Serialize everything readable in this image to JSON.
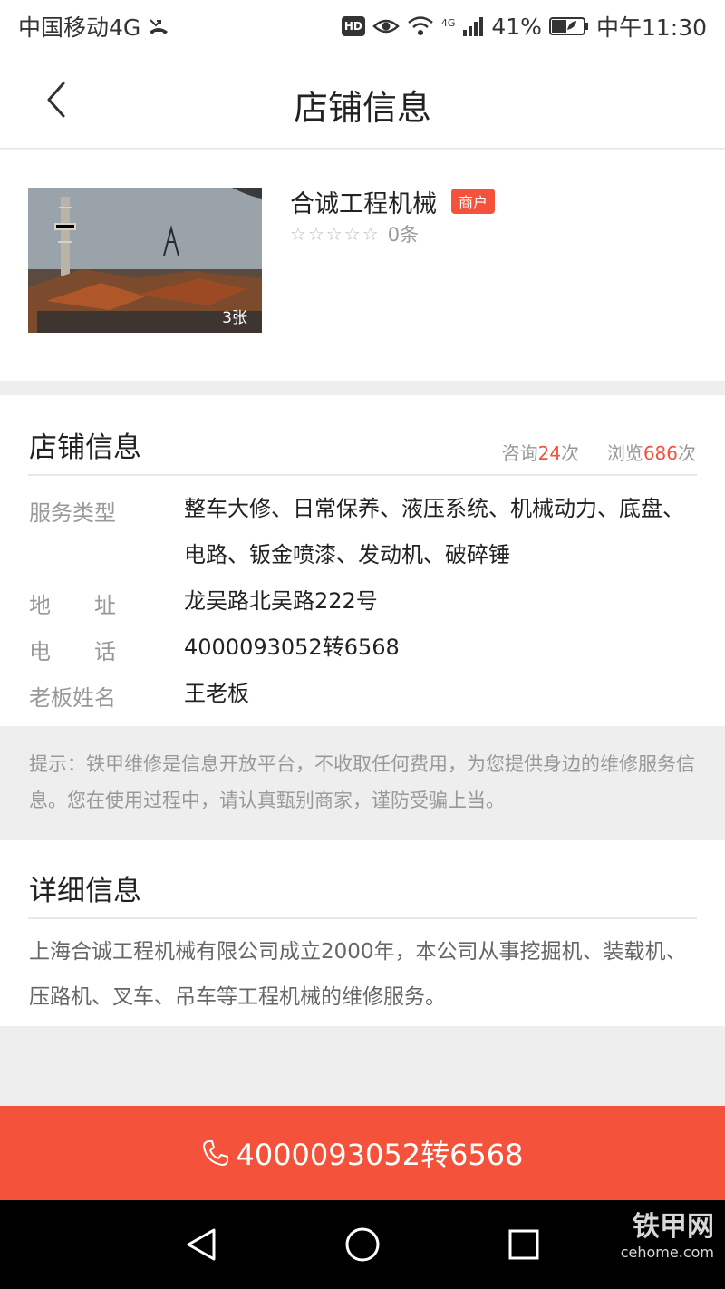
{
  "status_bar": {
    "carrier": "中国移动4G",
    "hd": "HD",
    "signal_tag": "4G",
    "battery": "41%",
    "time": "中午11:30"
  },
  "nav": {
    "title": "店铺信息"
  },
  "shop": {
    "name": "合诚工程机械",
    "badge": "商户",
    "photo_count": "3张",
    "stars": [
      "☆",
      "☆",
      "☆",
      "☆",
      "☆"
    ],
    "review_count": "0条"
  },
  "info": {
    "title": "店铺信息",
    "consult_prefix": "咨询",
    "consult_count": "24",
    "consult_suffix": "次",
    "view_prefix": "浏览",
    "view_count": "686",
    "view_suffix": "次",
    "rows": [
      {
        "label": "服务类型",
        "value": "整车大修、日常保养、液压系统、机械动力、底盘、电路、钣金喷漆、发动机、破碎锤"
      },
      {
        "label": "地　　址",
        "value": "龙吴路北吴路222号"
      },
      {
        "label": "电　　话",
        "value": "4000093052转6568"
      },
      {
        "label": "老板姓名",
        "value": "王老板"
      }
    ]
  },
  "notice": {
    "text": "提示：铁甲维修是信息开放平台，不收取任何费用，为您提供身边的维修服务信息。您在使用过程中，请认真甄别商家，谨防受骗上当。"
  },
  "detail": {
    "title": "详细信息",
    "text": "上海合诚工程机械有限公司成立2000年，本公司从事挖掘机、装载机、压路机、叉车、吊车等工程机械的维修服务。"
  },
  "call_button": {
    "label": "4000093052转6568"
  },
  "watermark": {
    "text": "铁甲网",
    "sub": "cehome.com"
  },
  "colors": {
    "accent": "#f4523b",
    "muted": "#999999"
  }
}
